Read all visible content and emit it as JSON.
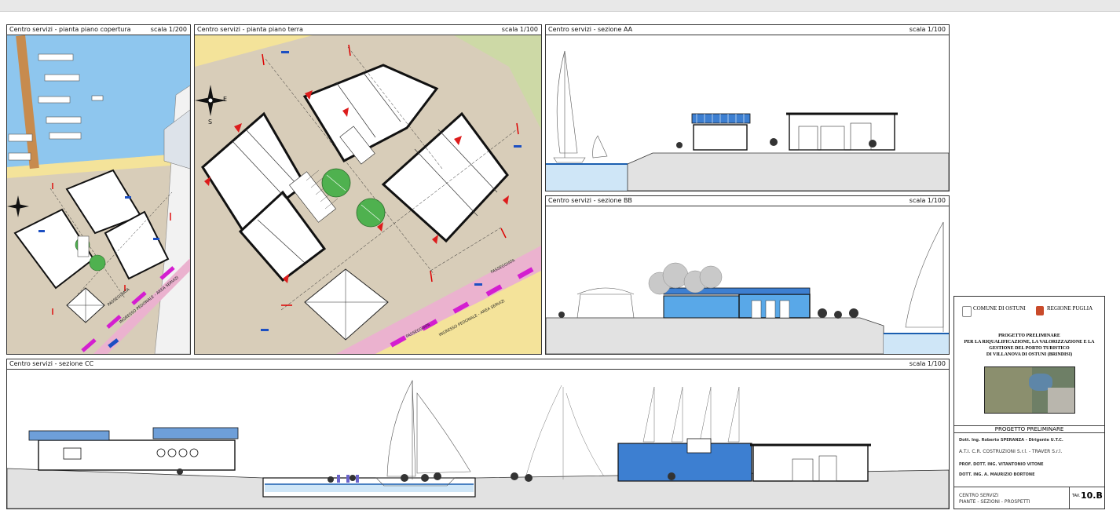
{
  "panels": {
    "roof": {
      "title": "Centro servizi - pianta piano copertura",
      "scale": "scala 1/200"
    },
    "ground": {
      "title": "Centro servizi - pianta piano terra",
      "scale": "scala 1/100"
    },
    "aa": {
      "title": "Centro servizi - sezione AA",
      "scale": "scala 1/100"
    },
    "bb": {
      "title": "Centro servizi - sezione BB",
      "scale": "scala 1/100"
    },
    "cc": {
      "title": "Centro servizi - sezione CC",
      "scale": "scala 1/100"
    }
  },
  "plan_labels": {
    "passeggiata1": "PASSEGGIATA",
    "ingresso1": "INGRESSO PEDONALE - AREA SERVIZI",
    "passeggiata2": "PASSEGGIATA",
    "ingresso2": "INGRESSO PEDONALE - AREA SERVIZI",
    "passeggiata3": "PASSEGGIATA",
    "compass_e": "E",
    "compass_s": "S"
  },
  "titleblock": {
    "comune": "COMUNE DI OSTUNI",
    "regione": "REGIONE PUGLIA",
    "project_line1": "PROGETTO PRELIMINARE",
    "project_line2": "PER LA RIQUALIFICAZIONE, LA VALORIZZAZIONE E LA",
    "project_line3": "GESTIONE DEL PORTO TURISTICO",
    "project_line4": "DI VILLANOVA DI OSTUNI (BRINDISI)",
    "phase": "PROGETTO PRELIMINARE",
    "rup": "Dott. Ing. Roberto SPERANZA - Dirigente U.T.C.",
    "company": "A.T.I. C.R. COSTRUZIONI S.r.l. - TRAVER S.r.l.",
    "designer1": "PROF. DOTT. ING. VITANTONIO VITONE",
    "designer2": "DOTT. ING. A. MAURIZIO BORTONE",
    "drawing_title1": "CENTRO SERVIZI",
    "drawing_title2": "PIANTE - SEZIONI - PROSPETTI",
    "tav_label": "TAV.",
    "tav_number": "10.B"
  }
}
